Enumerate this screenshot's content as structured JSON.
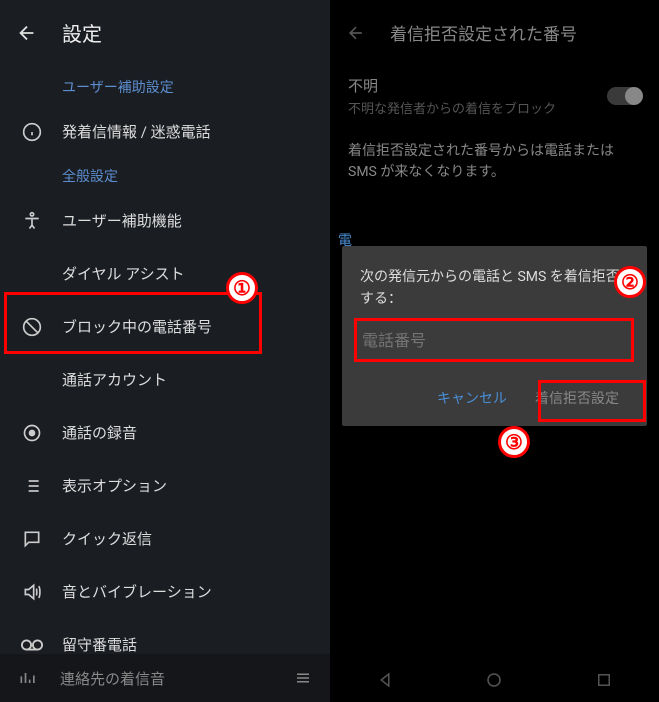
{
  "left": {
    "header_title": "設定",
    "section1": "ユーザー補助設定",
    "item_caller_spam": "発着信情報 / 迷惑電話",
    "section2": "全般設定",
    "item_accessibility": "ユーザー補助機能",
    "item_dial_assist": "ダイヤル アシスト",
    "item_blocked": "ブロック中の電話番号",
    "item_call_account": "通話アカウント",
    "item_recording": "通話の録音",
    "item_display": "表示オプション",
    "item_quick_reply": "クイック返信",
    "item_sound": "音とバイブレーション",
    "item_voicemail": "留守番電話",
    "bottom_label": "連絡先の着信音"
  },
  "right": {
    "header_title": "着信拒否設定された番号",
    "unknown_title": "不明",
    "unknown_desc": "不明な発信者からの着信をブロック",
    "info_text": "着信拒否設定された番号からは電話または SMS が来なくなります。",
    "side_letter": "電",
    "dialog_msg": "次の発信元からの電話と SMS を着信拒否する：",
    "dialog_placeholder": "電話番号",
    "dialog_cancel": "キャンセル",
    "dialog_confirm": "着信拒否設定"
  },
  "badges": {
    "one": "①",
    "two": "②",
    "three": "③"
  }
}
